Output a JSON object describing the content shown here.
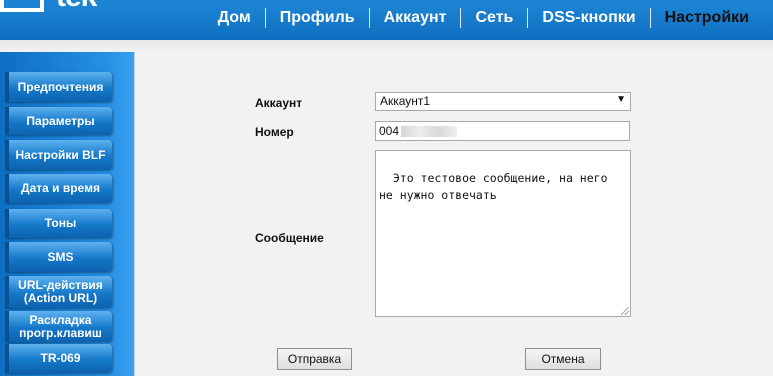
{
  "brand": {
    "logo_text": "tek"
  },
  "nav": {
    "items": [
      "Дом",
      "Профиль",
      "Аккаунт",
      "Сеть",
      "DSS-кнопки",
      "Настройки"
    ],
    "active": "Настройки"
  },
  "sidebar": {
    "items": [
      "Предпочтения",
      "Параметры",
      "Настройки BLF",
      "Дата и время",
      "Тоны",
      "SMS",
      "URL-действия\n(Action URL)",
      "Раскладка\nпрогр.клавиш",
      "TR-069"
    ]
  },
  "form": {
    "account_label": "Аккаунт",
    "account_value": "Аккаунт1",
    "number_label": "Номер",
    "number_value_visible": "004",
    "message_label": "Сообщение",
    "message_value": "Это тестовое сообщение, на него не нужно отвечать",
    "send_button": "Отправка",
    "cancel_button": "Отмена"
  },
  "colors": {
    "header_blue": "#1476c8",
    "sidebar_blue": "#1478c9",
    "page_bg": "#f2f2f2"
  }
}
